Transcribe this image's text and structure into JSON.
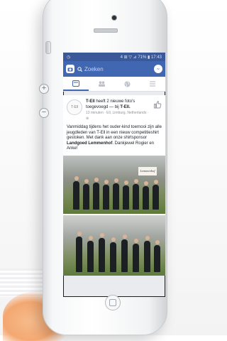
{
  "status": {
    "signal": "4 ⊞ ▽ ⊿ 71% ▮ 17:43"
  },
  "search": {
    "placeholder": "Zoeken"
  },
  "tabs": [
    {
      "name": "tab-feed",
      "icon": "feed-icon",
      "active": true
    },
    {
      "name": "tab-friends",
      "icon": "friends-icon",
      "active": false
    },
    {
      "name": "tab-world",
      "icon": "globe-icon",
      "active": false
    },
    {
      "name": "tab-menu",
      "icon": "menu-icon",
      "active": false
    }
  ],
  "post": {
    "avatar_text": "T-Ell",
    "author": "T-Ell",
    "action": "heeft 2 nieuwe foto's toegevoegd",
    "with_prefix": "— bij",
    "page": "T-Ell.",
    "meta": "13 minuten · Ell, Limburg, Netherlands · ⊛",
    "text_before": "Vanmiddag tijdens het ouder-kind toernooi zijn alle jeugdleden van T-Ell in een nieuw competitieshirt gestoken. Met dank aan onze shirtsponsor ",
    "sponsor": "Landgoed Lemmenhof",
    "text_after": ". Dankjewel Rogier en Anke!",
    "photo_sign": "Lemmenhof"
  },
  "colors": {
    "brand": "#3b5998",
    "bar": "#4267b2"
  }
}
